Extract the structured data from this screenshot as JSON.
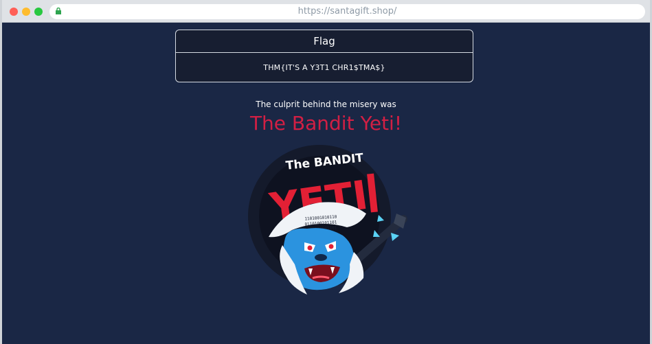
{
  "browser": {
    "url": "https://santagift.shop/"
  },
  "flag": {
    "title": "Flag",
    "value": "THM{IT'S A Y3T1 CHR1$TMA$}"
  },
  "reveal": {
    "subtitle": "The culprit behind the misery was",
    "name": "The Bandit Yeti!"
  },
  "logo": {
    "top_text": "The BANDIT",
    "main_text": "YETI",
    "binary": "1101001010110 0110100101101 1001011001101"
  },
  "colors": {
    "page_bg": "#1a2745",
    "accent_red": "#d21f44",
    "yeti_blue": "#2b93df"
  }
}
